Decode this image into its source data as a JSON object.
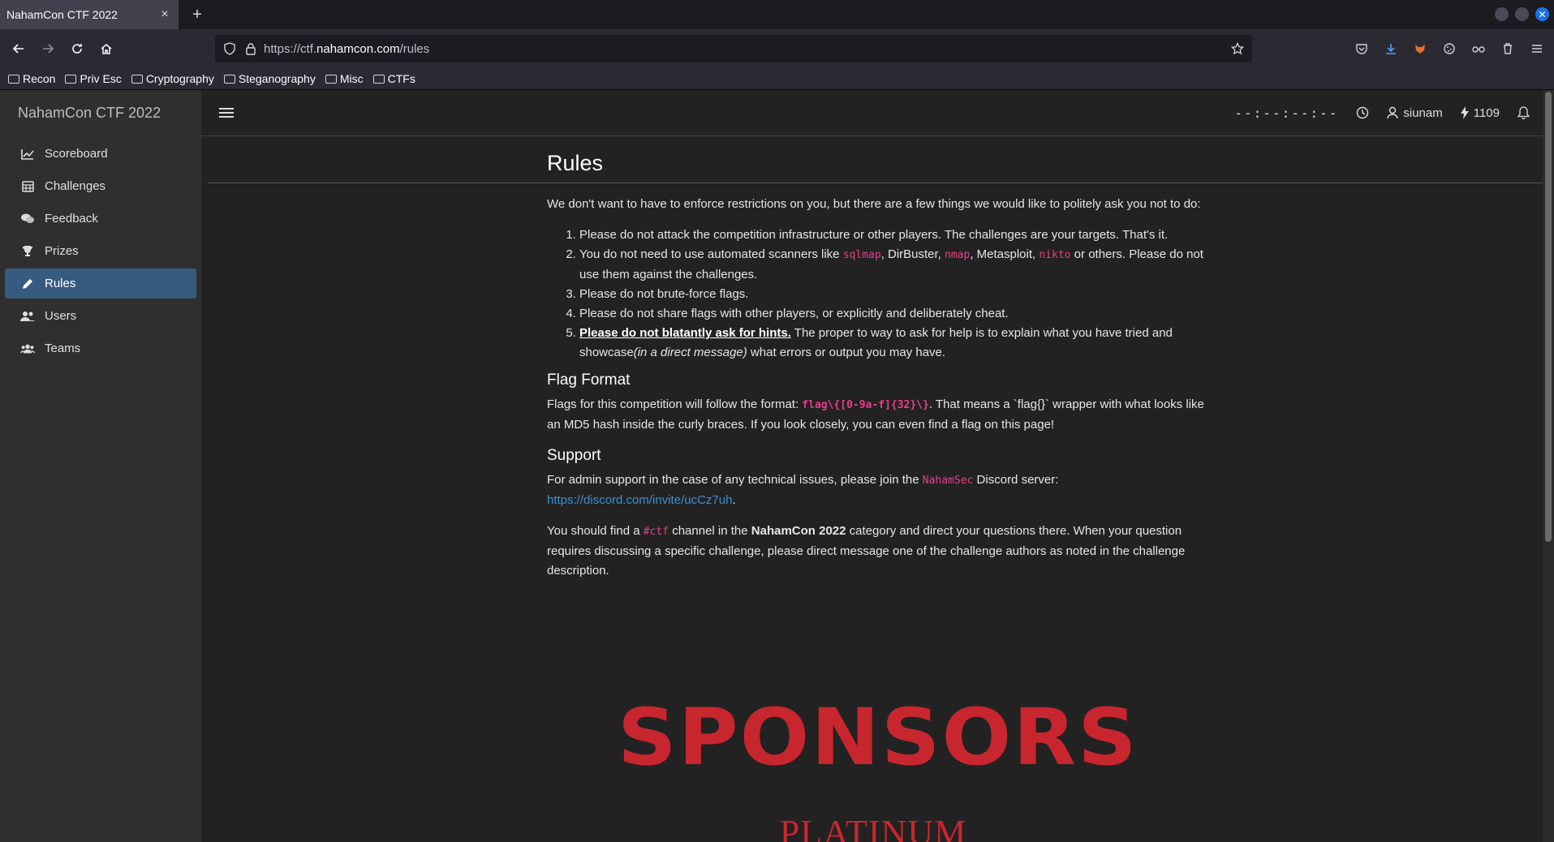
{
  "browser": {
    "tab_title": "NahamCon CTF 2022",
    "tab_close": "×",
    "new_tab": "+",
    "url_prefix": "https://ctf.",
    "url_domain": "nahamcon.com",
    "url_path": "/rules",
    "bookmarks": [
      "Recon",
      "Priv Esc",
      "Cryptography",
      "Steganography",
      "Misc",
      "CTFs"
    ]
  },
  "site": {
    "brand": "NahamCon CTF 2022",
    "nav": [
      {
        "label": "Scoreboard",
        "icon": "chart-line-icon"
      },
      {
        "label": "Challenges",
        "icon": "calendar-icon"
      },
      {
        "label": "Feedback",
        "icon": "comments-icon"
      },
      {
        "label": "Prizes",
        "icon": "trophy-icon"
      },
      {
        "label": "Rules",
        "icon": "pencil-icon"
      },
      {
        "label": "Users",
        "icon": "user-group-icon"
      },
      {
        "label": "Teams",
        "icon": "users-icon"
      }
    ],
    "timer": "--:--:--:--",
    "username": "siunam",
    "points": "1109"
  },
  "rules": {
    "title": "Rules",
    "intro": "We don't want to have to enforce restrictions on you, but there are a few things we would like to politely ask you not to do:",
    "item1": "Please do not attack the competition infrastructure or other players. The challenges are your targets. That's it.",
    "item2_a": "You do not need to use automated scanners like ",
    "item2_sqlmap": "sqlmap",
    "item2_b": ", DirBuster, ",
    "item2_nmap": "nmap",
    "item2_c": ", Metasploit, ",
    "item2_nikto": "nikto",
    "item2_d": " or others. Please do not use them against the challenges.",
    "item3": "Please do not brute-force flags.",
    "item4": "Please do not share flags with other players, or explicitly and deliberately cheat.",
    "item5_strong": "Please do not blatantly ask for hints.",
    "item5_a": " The proper to way to ask for help is to explain what you have tried and showcase",
    "item5_em": "(in a direct message)",
    "item5_b": " what errors or output you may have.",
    "flag_heading": "Flag Format",
    "flag_a": "Flags for this competition will follow the format: ",
    "flag_code": "flag\\{[0-9a-f]{32}\\}",
    "flag_b": ". That means a `flag{}` wrapper with what looks like an MD5 hash inside the curly braces. If you look closely, you can even find a flag on this page!",
    "support_heading": "Support",
    "support_a": "For admin support in the case of any technical issues, please join the ",
    "support_code": "NahamSec",
    "support_b": " Discord server: ",
    "support_link": "https://discord.com/invite/ucCz7uh",
    "support_c": ".",
    "channel_a": "You should find a ",
    "channel_code": "#ctf",
    "channel_b": " channel in the ",
    "channel_strong": "NahamCon 2022",
    "channel_c": " category and direct your questions there. When your question requires discussing a specific challenge, please direct message one of the challenge authors as noted in the challenge description.",
    "sponsors": "SPONSORS",
    "platinum": "PLATINUM"
  },
  "colors": {
    "active_nav": "#375a7f",
    "code_pink": "#e83e8c",
    "sponsor_red": "#c8262e",
    "link_blue": "#3d8fd1"
  }
}
